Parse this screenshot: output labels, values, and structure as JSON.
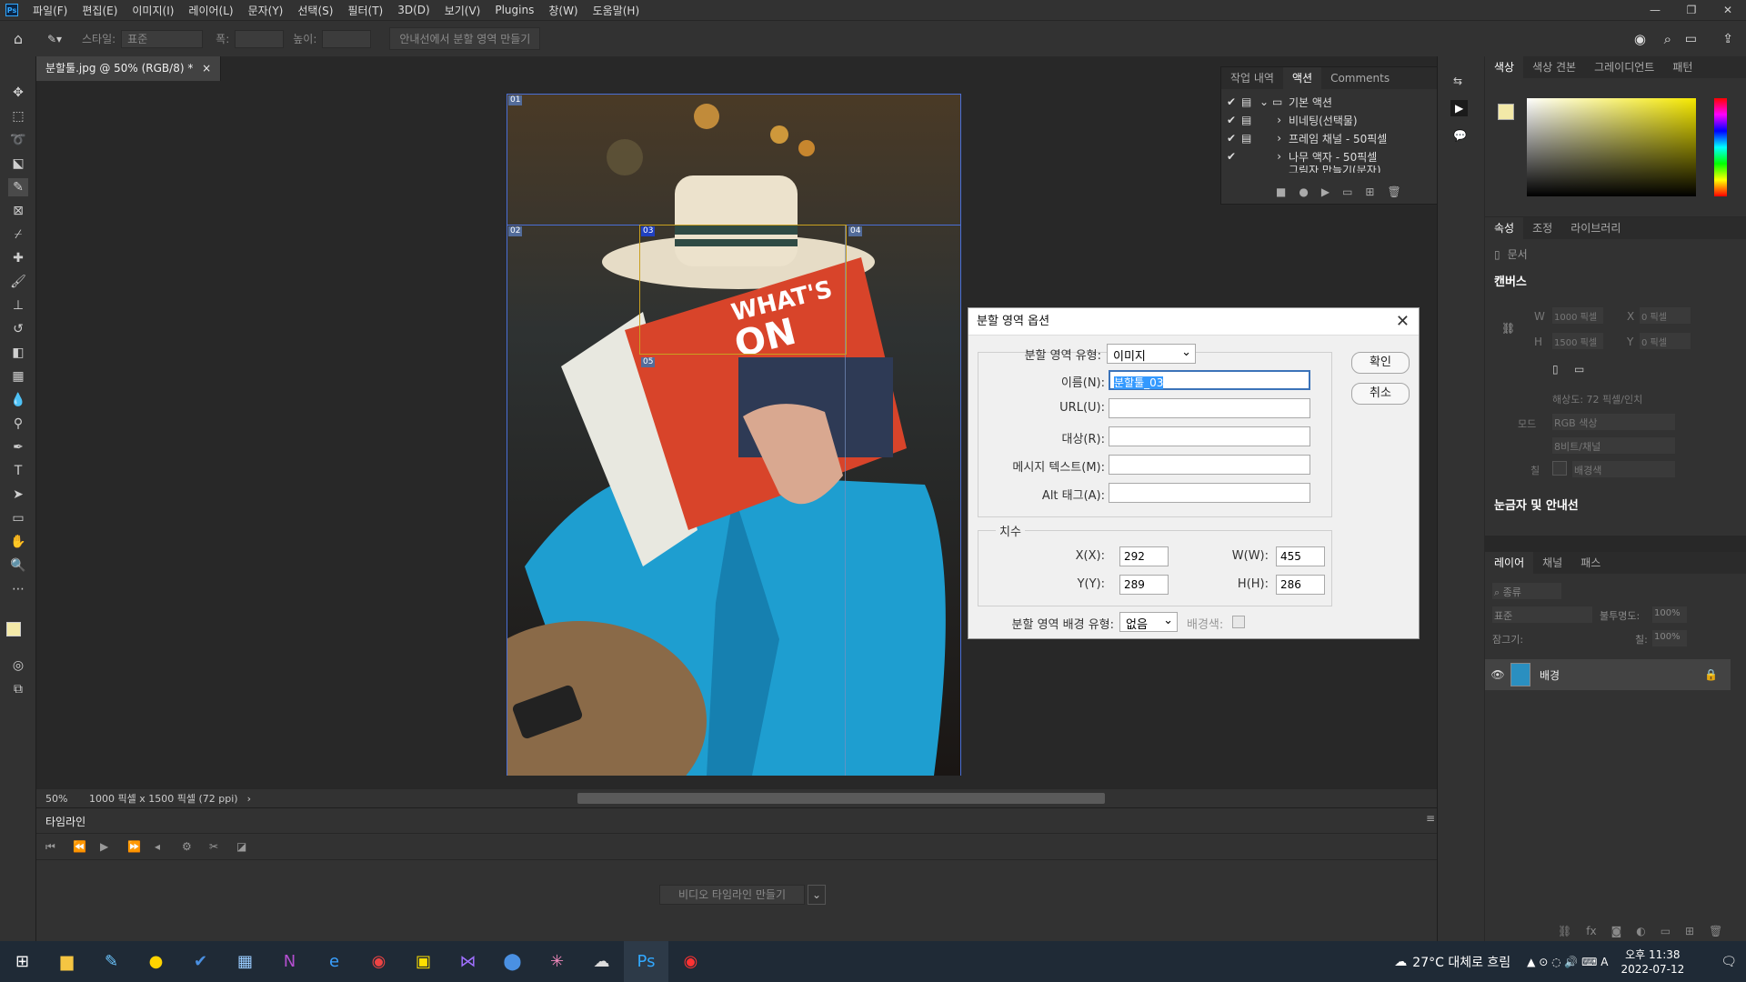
{
  "app": {
    "logo": "Ps",
    "menu": [
      "파일(F)",
      "편집(E)",
      "이미지(I)",
      "레이어(L)",
      "문자(Y)",
      "선택(S)",
      "필터(T)",
      "3D(D)",
      "보기(V)",
      "Plugins",
      "창(W)",
      "도움말(H)"
    ]
  },
  "options": {
    "style_label": "스타일:",
    "style_value": "표준",
    "width_label": "폭:",
    "height_label": "높이:",
    "guides_button": "안내선에서 분할 영역 만들기"
  },
  "document": {
    "tab_title": "분할툴.jpg @ 50% (RGB/8) *",
    "zoom": "50%",
    "info": "1000 픽셀 x 1500 픽셀 (72 ppi)"
  },
  "slices": [
    "01",
    "02",
    "03",
    "04",
    "05"
  ],
  "actions_panel": {
    "tabs": [
      "작업 내역",
      "액션",
      "Comments"
    ],
    "items": [
      "기본 액션",
      "비네팅(선택물)",
      "프레임 채널 - 50픽셀",
      "나무 액자 - 50픽셀",
      "그림자 만들기(문자)"
    ]
  },
  "color_panel": {
    "tabs": [
      "색상",
      "색상 견본",
      "그레이디언트",
      "패턴"
    ],
    "foreground": "#f3e9a8",
    "background": "#9ab8c8"
  },
  "properties_panel": {
    "tabs": [
      "속성",
      "조정",
      "라이브러리"
    ],
    "doc_label": "문서",
    "canvas_title": "캔버스",
    "w_label": "W",
    "w_value": "1000 픽셀",
    "h_label": "H",
    "h_value": "1500 픽셀",
    "x_label": "X",
    "x_value": "0 픽셀",
    "y_label": "Y",
    "y_value": "0 픽셀",
    "resolution": "해상도: 72 픽셀/인치",
    "mode_label": "모드",
    "mode_value": "RGB 색상",
    "bits_value": "8비트/채널",
    "fill_label": "칠",
    "fill_value": "배경색",
    "rulers_title": "눈금자 및 안내선"
  },
  "layers_panel": {
    "tabs": [
      "레이어",
      "채널",
      "패스"
    ],
    "kind_label": "종류",
    "blend_mode": "표준",
    "opacity_label": "불투명도:",
    "opacity_value": "100%",
    "lock_label": "잠그기:",
    "fill_label": "칠:",
    "fill_value": "100%",
    "layer_name": "배경"
  },
  "timeline": {
    "title": "타임라인",
    "create_button": "비디오 타임라인 만들기"
  },
  "dialog": {
    "title": "분할 영역 옵션",
    "type_label": "분할 영역 유형:",
    "type_value": "이미지",
    "name_label": "이름(N):",
    "name_value": "분할툴_03",
    "url_label": "URL(U):",
    "url_value": "",
    "target_label": "대상(R):",
    "target_value": "",
    "message_label": "메시지 텍스트(M):",
    "message_value": "",
    "alt_label": "Alt 태그(A):",
    "alt_value": "",
    "dimensions_title": "치수",
    "x_label": "X(X):",
    "x_value": "292",
    "y_label": "Y(Y):",
    "y_value": "289",
    "w_label": "W(W):",
    "w_value": "455",
    "h_label": "H(H):",
    "h_value": "286",
    "bg_type_label": "분할 영역 배경 유형:",
    "bg_type_value": "없음",
    "bg_color_label": "배경색:",
    "ok": "확인",
    "cancel": "취소"
  },
  "taskbar": {
    "weather": "27°C 대체로 흐림",
    "time": "오후 11:38",
    "date": "2022-07-12"
  }
}
